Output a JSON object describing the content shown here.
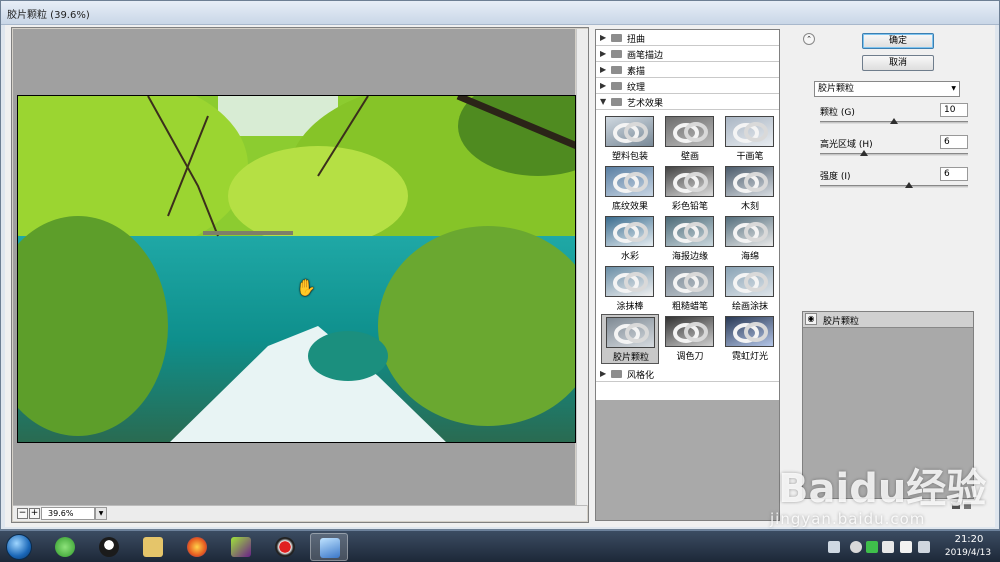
{
  "window": {
    "title": "胶片颗粒 (39.6%)"
  },
  "preview": {
    "zoom_minus": "−",
    "zoom_plus": "+",
    "zoom_value": "39.6%"
  },
  "filters": {
    "categories_top": [
      "扭曲",
      "画笔描边",
      "素描",
      "纹理"
    ],
    "open_category": "艺术效果",
    "thumbnails": [
      "塑料包装",
      "壁画",
      "干画笔",
      "底纹效果",
      "彩色铅笔",
      "木刻",
      "水彩",
      "海报边缘",
      "海绵",
      "涂抹棒",
      "粗糙蜡笔",
      "绘画涂抹",
      "胶片颗粒",
      "调色刀",
      "霓虹灯光"
    ],
    "selected_thumbnail": "胶片颗粒",
    "categories_bottom": [
      "风格化"
    ]
  },
  "buttons": {
    "ok": "确定",
    "cancel": "取消"
  },
  "settings": {
    "filter_select": "胶片颗粒",
    "params": [
      {
        "label": "颗粒 (G)",
        "value": "10",
        "min": 0,
        "max": 20
      },
      {
        "label": "高光区域 (H)",
        "value": "6",
        "min": 0,
        "max": 20
      },
      {
        "label": "强度 (I)",
        "value": "6",
        "min": 0,
        "max": 10
      }
    ]
  },
  "layers": {
    "items": [
      "胶片颗粒"
    ]
  },
  "taskbar": {
    "apps": [
      "browser-360",
      "qq",
      "file-explorer",
      "firefox",
      "media-player",
      "recorder",
      "photoshop"
    ],
    "time": "21:20",
    "date": "2019/4/13"
  },
  "watermark": {
    "main": "Baidu经验",
    "sub": "jingyan.baidu.com"
  },
  "colors": {
    "accent": "#3c7fb1",
    "preview_bg": "#a0a0a0",
    "taskbar": "#2a3a50"
  }
}
